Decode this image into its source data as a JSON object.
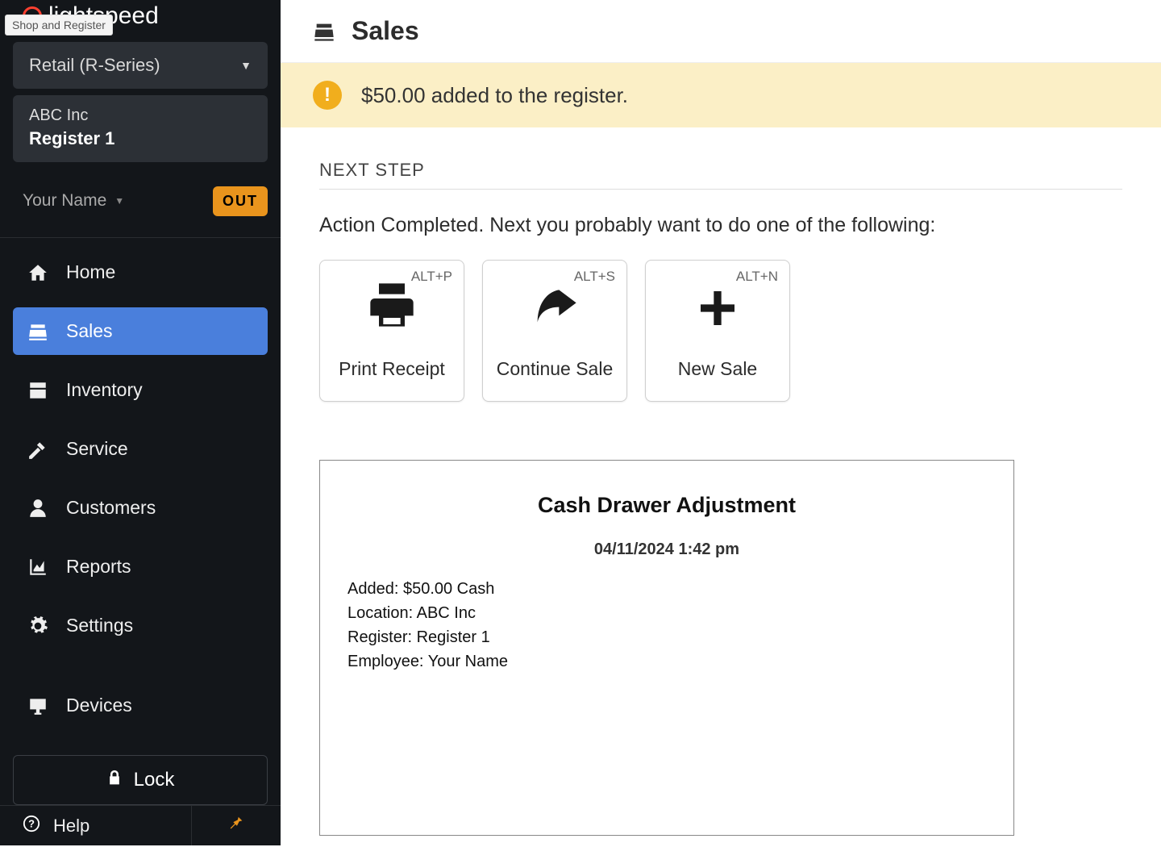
{
  "tooltip": "Shop and Register",
  "brand": {
    "name": "lightspeed"
  },
  "product_selector": {
    "label": "Retail (R-Series)"
  },
  "shop": {
    "company": "ABC Inc",
    "register": "Register 1"
  },
  "user": {
    "name": "Your Name",
    "out_label": "OUT"
  },
  "nav": {
    "home": "Home",
    "sales": "Sales",
    "inventory": "Inventory",
    "service": "Service",
    "customers": "Customers",
    "reports": "Reports",
    "settings": "Settings",
    "devices": "Devices"
  },
  "lock_label": "Lock",
  "help_label": "Help",
  "page_title": "Sales",
  "banner_message": "$50.00 added to the register.",
  "next_step_label": "NEXT STEP",
  "prompt_text": "Action Completed. Next you probably want to do one of the following:",
  "actions": {
    "print": {
      "label": "Print Receipt",
      "kbd": "ALT+P"
    },
    "continue": {
      "label": "Continue Sale",
      "kbd": "ALT+S"
    },
    "new": {
      "label": "New Sale",
      "kbd": "ALT+N"
    }
  },
  "receipt": {
    "title": "Cash Drawer Adjustment",
    "timestamp": "04/11/2024 1:42 pm",
    "added_line": "Added: $50.00 Cash",
    "location_line": "Location: ABC Inc",
    "register_line": "Register: Register 1",
    "employee_line": "Employee: Your Name"
  }
}
